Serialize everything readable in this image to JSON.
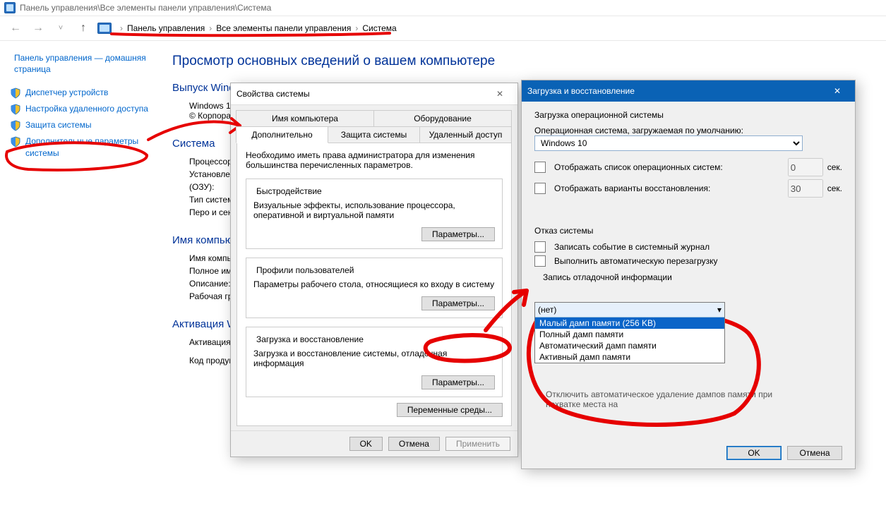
{
  "titlebar": {
    "path": "Панель управления\\Все элементы панели управления\\Система"
  },
  "breadcrumb": {
    "a": "Панель управления",
    "b": "Все элементы панели управления",
    "c": "Система",
    "sep": "›"
  },
  "sidebar": {
    "home": "Панель управления — домашняя страница",
    "items": [
      "Диспетчер устройств",
      "Настройка удаленного доступа",
      "Защита системы",
      "Дополнительные параметры системы"
    ]
  },
  "page": {
    "title": "Просмотр основных сведений о вашем компьютере",
    "editionHdr": "Выпуск Windows",
    "editionLine1": "Windows 10",
    "editionLine2": "© Корпорац",
    "systemHdr": "Система",
    "sysRows": [
      "Процессор:",
      "Установленн",
      "(ОЗУ):",
      "Тип системы",
      "Перо и сенс"
    ],
    "nameHdr": "Имя компьютер",
    "nameRows": [
      "Имя компьн",
      "Полное имя",
      "Описание:",
      "Рабочая гру"
    ],
    "activationHdr": "Активация Winc",
    "activationRow": "Активация W",
    "productRow": "Код продукт"
  },
  "sysprops": {
    "title": "Свойства системы",
    "tabs": {
      "top": [
        "Имя компьютера",
        "Оборудование"
      ],
      "bottom": [
        "Дополнительно",
        "Защита системы",
        "Удаленный доступ"
      ]
    },
    "intro": "Необходимо иметь права администратора для изменения большинства перечисленных параметров.",
    "perf": {
      "legend": "Быстродействие",
      "desc": "Визуальные эффекты, использование процессора, оперативной и виртуальной памяти"
    },
    "profiles": {
      "legend": "Профили пользователей",
      "desc": "Параметры рабочего стола, относящиеся ко входу в систему"
    },
    "startup": {
      "legend": "Загрузка и восстановление",
      "desc": "Загрузка и восстановление системы, отладочная информация"
    },
    "paramsBtn": "Параметры...",
    "envBtn": "Переменные среды...",
    "ok": "OK",
    "cancel": "Отмена",
    "apply": "Применить"
  },
  "startrec": {
    "title": "Загрузка и восстановление",
    "bootHdr": "Загрузка операционной системы",
    "defaultOsLbl": "Операционная система, загружаемая по умолчанию:",
    "defaultOs": "Windows 10",
    "showListChk": "Отображать список операционных систем:",
    "showListSec": "0",
    "secUnit": "сек.",
    "showRecChk": "Отображать варианты восстановления:",
    "showRecSec": "30",
    "failHdr": "Отказ системы",
    "logChk": "Записать событие в системный журнал",
    "restartChk": "Выполнить автоматическую перезагрузку",
    "debugHdr": "Запись отладочной информации",
    "selected": "(нет)",
    "options": [
      "Малый дамп памяти (256 KB)",
      "Полный дамп памяти",
      "Автоматический дамп памяти",
      "Активный дамп памяти"
    ],
    "overwriteCover": "Отключить автоматическое удаление дампов памяти при нехватке места на",
    "ok": "OK",
    "cancel": "Отмена"
  }
}
